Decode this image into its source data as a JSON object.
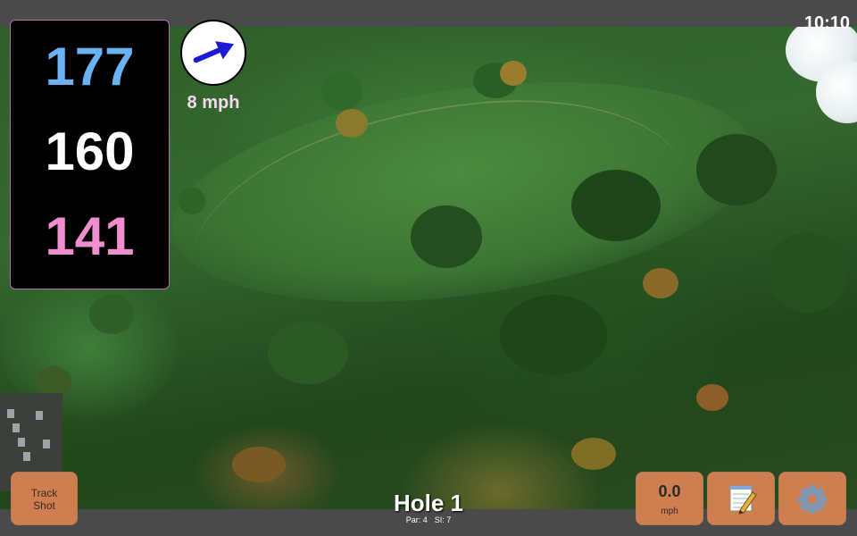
{
  "status": {
    "time": "10:10"
  },
  "distances": {
    "back": "177",
    "middle": "160",
    "front": "141"
  },
  "wind": {
    "speed": "8 mph",
    "direction_deg": 67,
    "arrow_color": "#1b1bd6"
  },
  "hole": {
    "title": "Hole 1",
    "par": "Par: 4",
    "stroke_index": "SI: 7"
  },
  "buttons": {
    "track_shot_line1": "Track",
    "track_shot_line2": "Shot",
    "speed_value": "0.0",
    "speed_unit": "mph",
    "notes_icon": "notepad-icon",
    "settings_icon": "gear-icon"
  },
  "colors": {
    "back_distance": "#6ab2f2",
    "middle_distance": "#ffffff",
    "front_distance": "#f08fcf",
    "button_bg": "#cf7e4f",
    "bar_bg": "#4a4a4a"
  }
}
